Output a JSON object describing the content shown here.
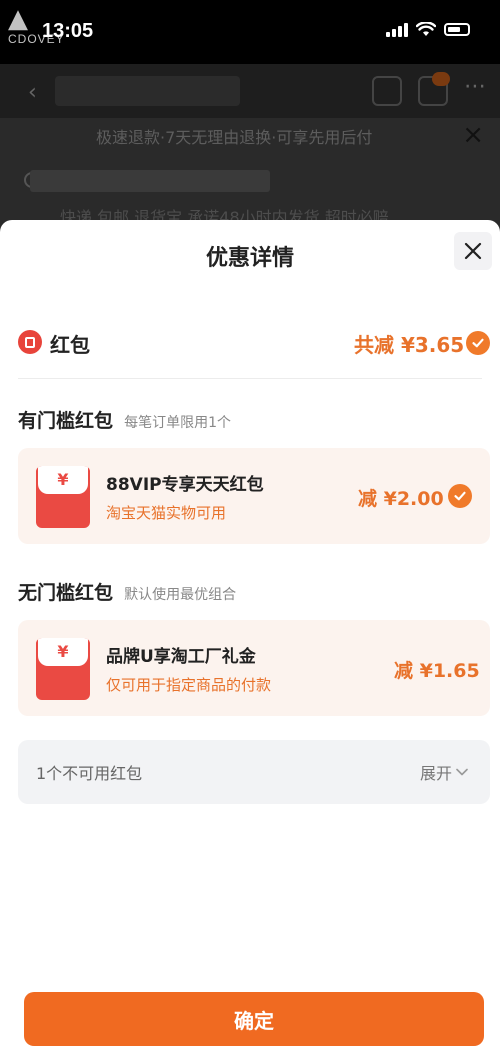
{
  "status_bar": {
    "time": "13:05"
  },
  "logo": {
    "mark": "▲",
    "text": "CDOVEY"
  },
  "background": {
    "notice": "极速退款·7天无理由退换·可享先用后付",
    "shipping": "快递 包邮 退货宝 承诺48小时内发货 超时必赔"
  },
  "sheet": {
    "title": "优惠详情",
    "summary": {
      "label": "红包",
      "total": "共减 ¥3.65"
    },
    "threshold": {
      "title": "有门槛红包",
      "subtitle": "每笔订单限用1个",
      "coupon": {
        "yen": "¥",
        "name": "88VIP专享天天红包",
        "desc": "淘宝天猫实物可用",
        "amount": "减 ¥2.00",
        "selected": true
      }
    },
    "no_threshold": {
      "title": "无门槛红包",
      "subtitle": "默认使用最优组合",
      "coupon": {
        "yen": "¥",
        "name": "品牌U享淘工厂礼金",
        "desc": "仅可用于指定商品的付款",
        "amount": "减 ¥1.65"
      }
    },
    "unavailable": {
      "text": "1个不可用红包",
      "expand": "展开"
    },
    "confirm_label": "确定"
  },
  "colors": {
    "accent": "#f06a21",
    "red": "#ea4a43",
    "orange_text": "#e8722b"
  }
}
